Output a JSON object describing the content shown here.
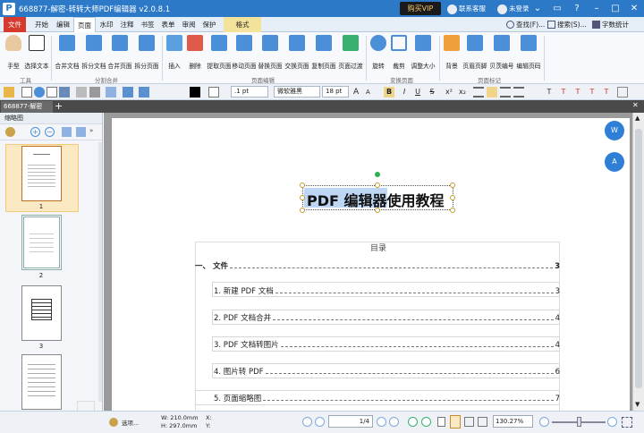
{
  "window": {
    "title": "668877-解密-转转大师PDF编辑器 v2.0.8.1",
    "logo_text": "P",
    "vip_button": "购买VIP",
    "support": "联系客服",
    "login": "未登录"
  },
  "menu": {
    "tabs": [
      "文件",
      "开始",
      "编辑",
      "页面",
      "水印",
      "注释",
      "书签",
      "表单",
      "审阅",
      "保护",
      "格式"
    ],
    "active": "页面",
    "right": {
      "find": "查找(F)...",
      "search": "搜索(S)...",
      "word_count": "字数统计"
    }
  },
  "ribbon": {
    "buttons": [
      "手型",
      "选择文本",
      "合并文档",
      "拆分文档",
      "合并页面",
      "拆分页面",
      "插入",
      "删除",
      "提取页面",
      "移动页面",
      "替换页面",
      "交换页面",
      "复制页面",
      "页面过渡",
      "旋转",
      "裁剪",
      "调整大小",
      "背景",
      "页眉页脚",
      "贝茨编号",
      "编辑页码"
    ],
    "groups": [
      "工具",
      "分割合并",
      "页面编辑",
      "变换页面",
      "页面标记"
    ]
  },
  "format_bar": {
    "line_width": ".1 pt",
    "font": "微软雅黑",
    "font_size": "18 pt"
  },
  "doc_tab": {
    "name": "668877-解密"
  },
  "sidebar": {
    "title": "缩略图",
    "pages": [
      "1",
      "2",
      "3",
      "4"
    ]
  },
  "document": {
    "title": "PDF 编辑器使用教程",
    "title_selected": "PDF 编辑器",
    "toc_heading": "目录",
    "toc": [
      {
        "label": "一、  文件",
        "page": "3",
        "bold": true
      },
      {
        "label": "1.  新建 PDF 文档",
        "page": "3"
      },
      {
        "label": "2. PDF 文档合并",
        "page": "4"
      },
      {
        "label": "3. PDF 文档转图片",
        "page": "4"
      },
      {
        "label": "4.  图片转 PDF",
        "page": "6"
      },
      {
        "label": "5.  页面缩略图",
        "page": "7"
      }
    ]
  },
  "statusbar": {
    "options": "选项...",
    "width": "W: 210.0mm",
    "height": "H: 297.0mm",
    "x": "X:",
    "y": "Y:",
    "page_current": "1",
    "page_total": "/4",
    "zoom": "130.27%"
  }
}
